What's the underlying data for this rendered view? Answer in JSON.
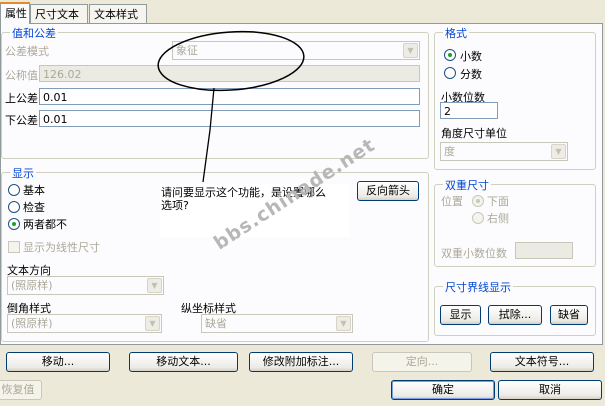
{
  "tabs": [
    {
      "label": "属性",
      "active": true
    },
    {
      "label": "尺寸文本",
      "active": false
    },
    {
      "label": "文本样式",
      "active": false
    }
  ],
  "tolerance": {
    "title": "值和公差",
    "mode_label": "公差模式",
    "mode_value": "象征",
    "nominal_label": "公称值",
    "nominal_value": "126.02",
    "upper_label": "上公差",
    "upper_value": "0.01",
    "lower_label": "下公差",
    "lower_value": "0.01"
  },
  "format": {
    "title": "格式",
    "decimal_label": "小数",
    "fraction_label": "分数",
    "decimal_places_label": "小数位数",
    "decimal_places_value": "2",
    "angle_unit_label": "角度尺寸单位",
    "angle_unit_value": "度"
  },
  "display": {
    "title": "显示",
    "basic_label": "基本",
    "inspect_label": "检查",
    "neither_label": "两者都不",
    "linear_label": "显示为线性尺寸",
    "reverse_arrow_label": "反向箭头",
    "text_direction_label": "文本方向",
    "text_direction_value": "(照原样)",
    "chamfer_label": "倒角样式",
    "chamfer_value": "(照原样)",
    "ordinate_label": "纵坐标样式",
    "ordinate_value": "缺省"
  },
  "dual": {
    "title": "双重尺寸",
    "position_label": "位置",
    "below_label": "下面",
    "right_label": "右侧",
    "decimal_label": "双重小数位数"
  },
  "witness": {
    "title": "尺寸界线显示",
    "show_label": "显示",
    "erase_label": "拭除...",
    "default_label": "缺省"
  },
  "annotation": {
    "text": "请问要显示这个功能，是设置哪么选项?",
    "watermark": "bbs.chinade.net"
  },
  "bottom": {
    "move": "移动...",
    "move_text": "移动文本...",
    "modify": "修改附加标注...",
    "orient": "定向...",
    "text_symbol": "文本符号...",
    "restore": "恢复值",
    "ok": "确定",
    "cancel": "取消"
  },
  "colors": {
    "dialog_bg": "#ece9d8",
    "group_title": "#0046d5",
    "active_tab_accent": "#e68b2c"
  }
}
